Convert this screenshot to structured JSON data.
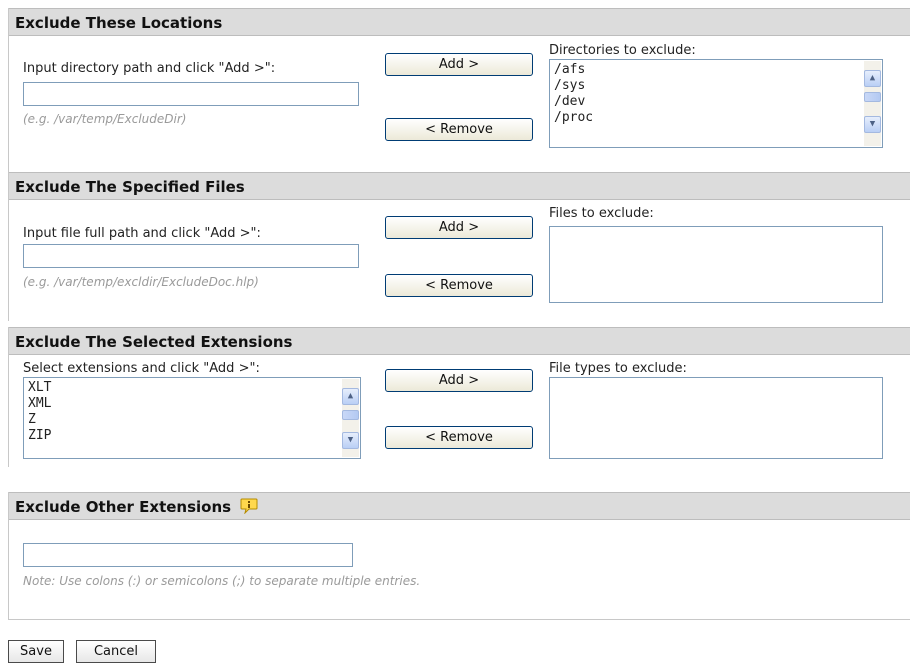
{
  "locations": {
    "title": "Exclude These Locations",
    "input_label": "Input directory path and click \"Add >\":",
    "input_value": "",
    "hint": "(e.g. /var/temp/ExcludeDir)",
    "add_label": "Add >",
    "remove_label": "< Remove",
    "list_label": "Directories to exclude:",
    "list_items": [
      "/afs",
      "/sys",
      "/dev",
      "/proc"
    ]
  },
  "files": {
    "title": "Exclude The Specified Files",
    "input_label": "Input file full path and click \"Add >\":",
    "input_value": "",
    "hint": "(e.g. /var/temp/excldir/ExcludeDoc.hlp)",
    "add_label": "Add >",
    "remove_label": "< Remove",
    "list_label": "Files to exclude:",
    "list_items": []
  },
  "extensions": {
    "title": "Exclude The Selected Extensions",
    "select_label": "Select extensions and click \"Add >\":",
    "select_items": [
      "XLT",
      "XML",
      "Z",
      "ZIP"
    ],
    "add_label": "Add >",
    "remove_label": "< Remove",
    "list_label": "File types to exclude:",
    "list_items": []
  },
  "other": {
    "title": "Exclude Other Extensions",
    "input_value": "",
    "note": "Note: Use colons (:) or semicolons (;) to separate multiple entries."
  },
  "actions": {
    "save_label": "Save",
    "cancel_label": "Cancel"
  },
  "icons": {
    "info": "info-speech-bubble-icon",
    "scroll_up": "scroll-up-icon",
    "scroll_down": "scroll-down-icon"
  },
  "colors": {
    "section_header_bg": "#dcdcdc",
    "input_border": "#7f9db9",
    "hint_text": "#9a9a9a"
  }
}
